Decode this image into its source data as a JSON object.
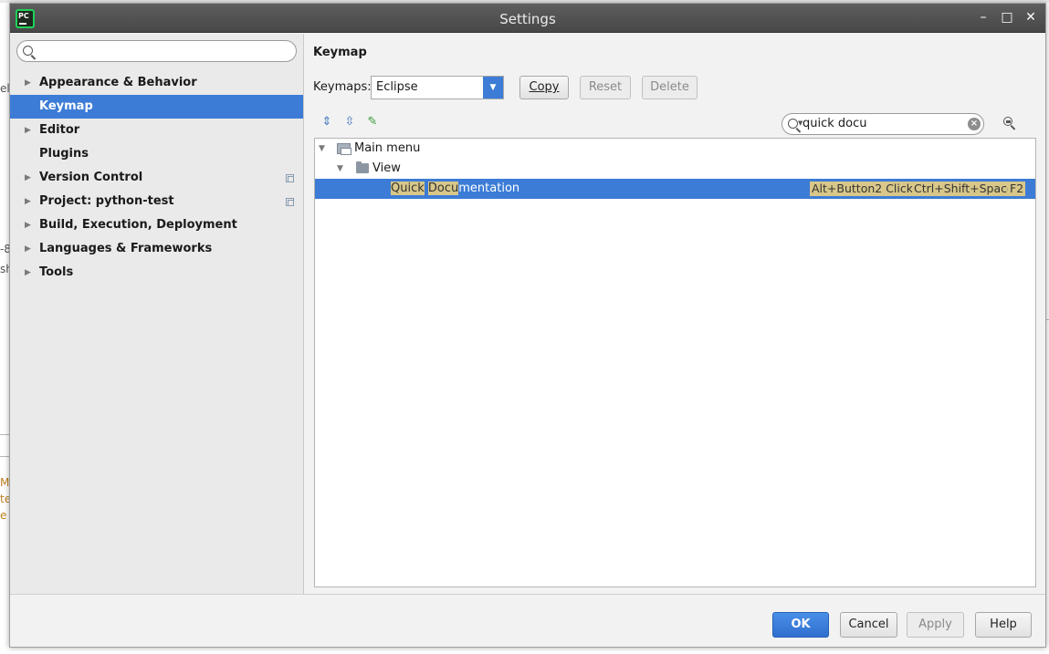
{
  "background": {
    "fragments": [
      "elf",
      "-8",
      "sh",
      "M",
      "te",
      "e"
    ]
  },
  "window": {
    "title": "Settings",
    "app_icon_text": "PC",
    "controls": {
      "minimize": "–",
      "maximize": "□",
      "close": "✕"
    }
  },
  "sidebar": {
    "search_placeholder": "",
    "items": [
      {
        "label": "Appearance & Behavior",
        "expandable": true
      },
      {
        "label": "Keymap",
        "selected": true
      },
      {
        "label": "Editor",
        "expandable": true
      },
      {
        "label": "Plugins"
      },
      {
        "label": "Version Control",
        "expandable": true,
        "project_icon": true
      },
      {
        "label": "Project: python-test",
        "expandable": true,
        "project_icon": true
      },
      {
        "label": "Build, Execution, Deployment",
        "expandable": true
      },
      {
        "label": "Languages & Frameworks",
        "expandable": true
      },
      {
        "label": "Tools",
        "expandable": true
      }
    ]
  },
  "keymap": {
    "section_title": "Keymap",
    "keymaps_label": "Keymaps:",
    "selected_keymap": "Eclipse",
    "buttons": {
      "copy": "Copy",
      "reset": "Reset",
      "delete": "Delete"
    },
    "filter_value": "quick docu",
    "tree": {
      "root": "Main menu",
      "child": "View",
      "action": {
        "highlight_1": "Quick",
        "highlight_2": "Docu",
        "rest": "mentation",
        "shortcuts": [
          "Alt+Button2 Click",
          "Ctrl+Shift+Space",
          "F2"
        ]
      }
    }
  },
  "footer": {
    "ok": "OK",
    "cancel": "Cancel",
    "apply": "Apply",
    "help": "Help"
  },
  "colors": {
    "accent": "#3c7cd6",
    "match_highlight": "#d8c789"
  }
}
